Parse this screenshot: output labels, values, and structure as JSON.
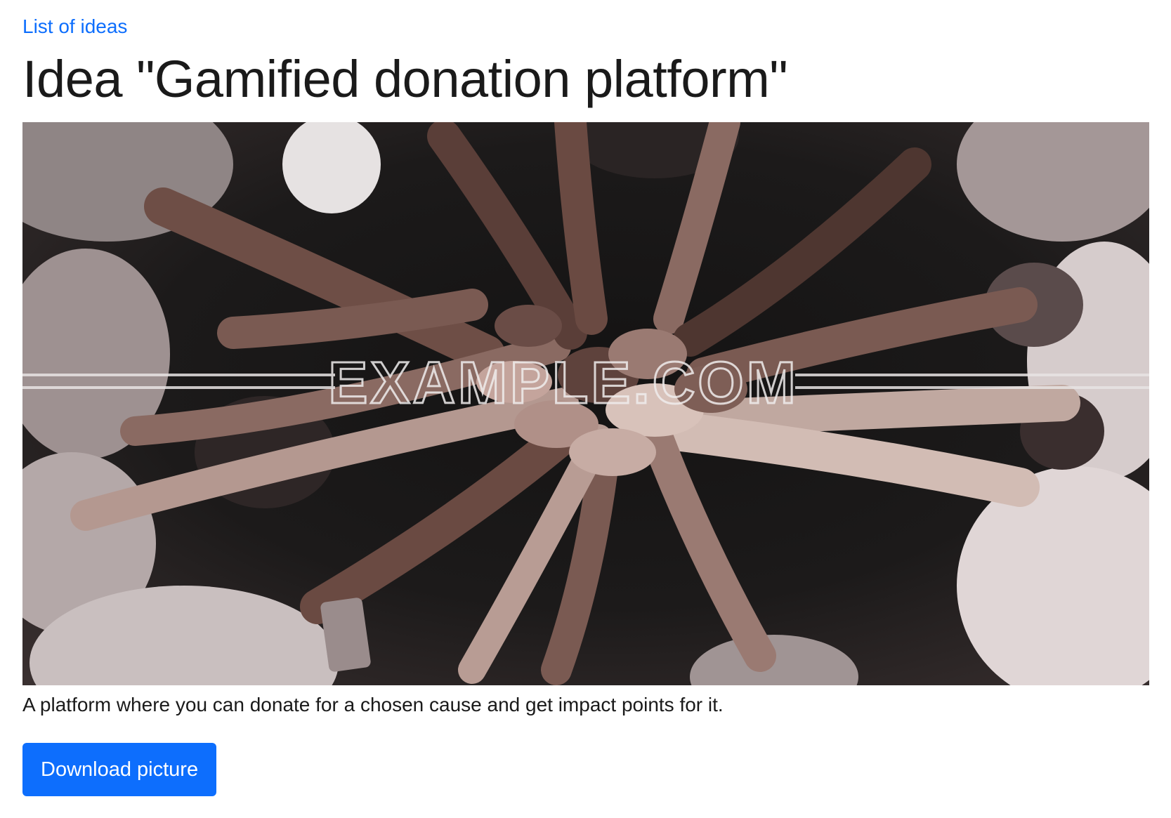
{
  "nav": {
    "back_link": "List of ideas"
  },
  "idea": {
    "title": "Idea \"Gamified donation platform\"",
    "description": "A platform where you can donate for a chosen cause and get impact points for it.",
    "picture": {
      "subject": "many hands reaching into a circle, top-down photo",
      "watermark": "EXAMPLE.COM"
    }
  },
  "actions": {
    "download_label": "Download picture"
  },
  "colors": {
    "link": "#0d6efd",
    "button_bg": "#0d6efd",
    "button_text": "#ffffff",
    "text": "#1a1a1a"
  }
}
